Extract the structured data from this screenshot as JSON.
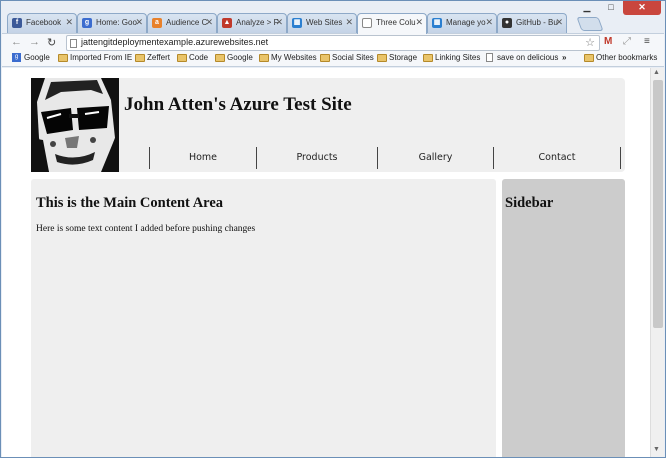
{
  "browser": {
    "tabs": [
      {
        "label": "Facebook",
        "icon": "facebook-icon",
        "color": "#3b5998",
        "glyph": "f"
      },
      {
        "label": "Home: Goo",
        "icon": "google-icon",
        "color": "#3b6ccf",
        "glyph": "g"
      },
      {
        "label": "Audience C",
        "icon": "analytics-icon",
        "color": "#e8812b",
        "glyph": "a"
      },
      {
        "label": "Analyze > F",
        "icon": "analyze-icon",
        "color": "#c0392b",
        "glyph": "▲"
      },
      {
        "label": "Web Sites",
        "icon": "windows-icon",
        "color": "#2b7fd0",
        "glyph": "▦"
      },
      {
        "label": "Three Colu",
        "icon": "page-icon",
        "color": "#ffffff",
        "glyph": ""
      },
      {
        "label": "Manage yo",
        "icon": "windows-icon",
        "color": "#2b7fd0",
        "glyph": "▦"
      },
      {
        "label": "GitHub - Bu",
        "icon": "github-icon",
        "color": "#333333",
        "glyph": "●"
      }
    ],
    "active_tab": 5,
    "url": "jattengitdeploymentexample.azurewebsites.net",
    "bookmarks": [
      {
        "label": "Google",
        "kind": "google"
      },
      {
        "label": "Imported From IE",
        "kind": "folder"
      },
      {
        "label": "Zeffert",
        "kind": "folder"
      },
      {
        "label": "Code",
        "kind": "folder"
      },
      {
        "label": "Google",
        "kind": "folder"
      },
      {
        "label": "My Websites",
        "kind": "folder"
      },
      {
        "label": "Social Sites",
        "kind": "folder"
      },
      {
        "label": "Storage",
        "kind": "folder"
      },
      {
        "label": "Linking Sites",
        "kind": "folder"
      },
      {
        "label": "save on delicious",
        "kind": "page"
      }
    ],
    "bookmarks_overflow": "»",
    "other_bookmarks": "Other bookmarks"
  },
  "page": {
    "site_title": "John Atten's Azure Test Site",
    "nav": [
      "Home",
      "Products",
      "Gallery",
      "Contact"
    ],
    "main_heading": "This is the Main Content Area",
    "main_text": "Here is some text content I added before pushing changes",
    "sidebar_heading": "Sidebar",
    "colors": {
      "header_bg": "#efefef",
      "main_bg": "#efefef",
      "sidebar_bg": "#cccccc"
    }
  }
}
